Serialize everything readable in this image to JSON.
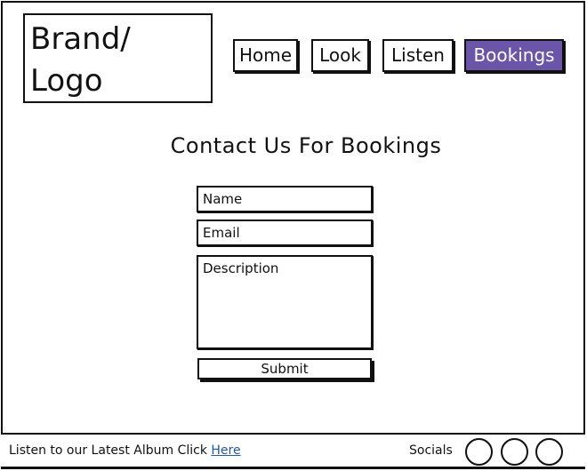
{
  "brand": {
    "text": "Brand/\nLogo"
  },
  "nav": {
    "home": "Home",
    "look": "Look",
    "listen": "Listen",
    "bookings": "Bookings"
  },
  "colors": {
    "active_nav": "#6a55a8",
    "link": "#1f5aa8"
  },
  "main": {
    "title": "Contact Us For Bookings",
    "form": {
      "name_placeholder": "Name",
      "email_placeholder": "Email",
      "description_placeholder": "Description",
      "submit_label": "Submit"
    }
  },
  "footer": {
    "album_text": "Listen to our Latest Album Click ",
    "album_link": "Here",
    "socials_label": "Socials",
    "social_icons": [
      "social-circle-icon",
      "social-circle-icon",
      "social-circle-icon"
    ]
  }
}
